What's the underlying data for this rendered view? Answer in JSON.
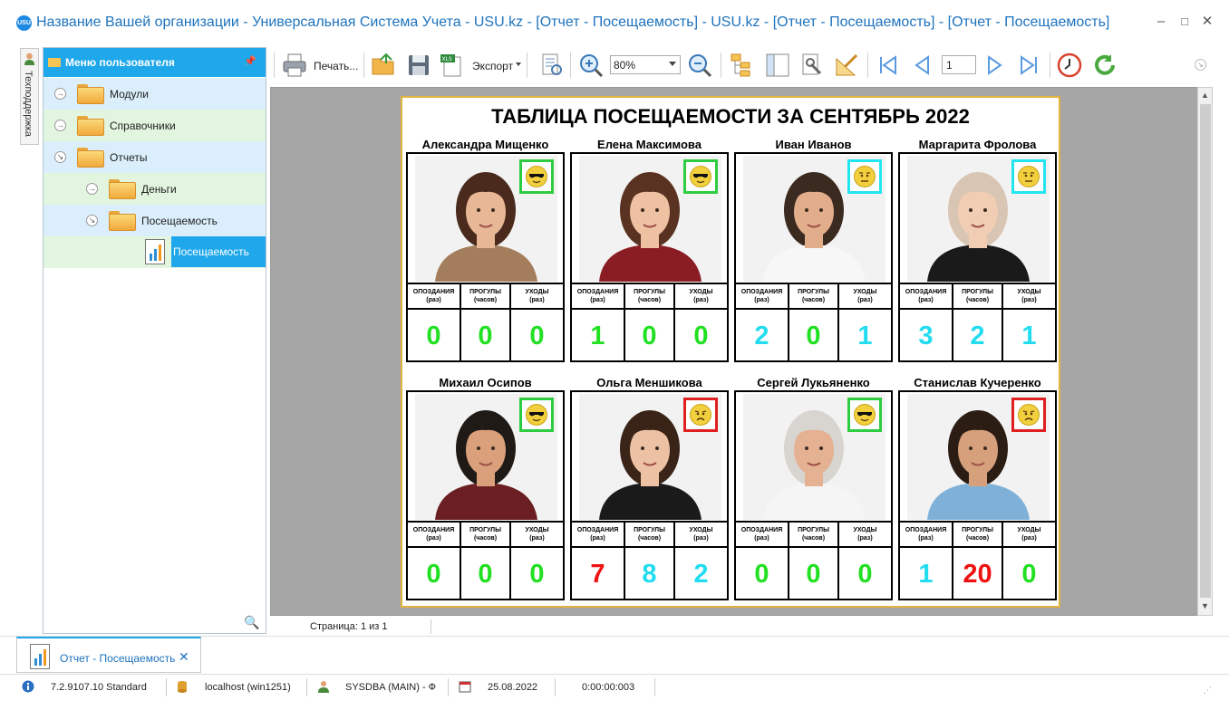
{
  "window": {
    "title": "Название Вашей организации - Универсальная Система Учета - USU.kz - [Отчет - Посещаемость] - USU.kz - [Отчет - Посещаемость] - [Отчет - Посещаемость]",
    "logo_text": "USU",
    "controls": {
      "minimize": "–",
      "maximize": "□",
      "close": "✕"
    }
  },
  "side_tab": {
    "label": "Техподдержка"
  },
  "menu": {
    "title": "Меню пользователя",
    "pin": "📌",
    "items": [
      {
        "label": "Модули",
        "expander": "→"
      },
      {
        "label": "Справочники",
        "expander": "→"
      },
      {
        "label": "Отчеты",
        "expander": "↘"
      },
      {
        "label": "Деньги",
        "expander": "→"
      },
      {
        "label": "Посещаемость",
        "expander": "↘"
      },
      {
        "label": "Посещаемость",
        "selected": true
      }
    ],
    "search_icon": "🔍"
  },
  "toolbar": {
    "print_label": "Печать...",
    "export_label": "Экспорт",
    "zoom_value": "80%",
    "page_value": "1"
  },
  "report": {
    "title": "ТАБЛИЦА ПОСЕЩАЕМОСТИ ЗА СЕНТЯБРЬ 2022",
    "col_lates": "ОПОЗДАНИЯ",
    "col_lates_unit": "(раз)",
    "col_absent": "ПРОГУЛЫ",
    "col_absent_unit": "(часов)",
    "col_leaves": "УХОДЫ",
    "col_leaves_unit": "(раз)",
    "employees": [
      {
        "name": "Александра Мищенко",
        "mood": "cool",
        "mood_color": "#2ecc40",
        "values": [
          "0",
          "0",
          "0"
        ],
        "colors": [
          "#22e022",
          "#22e022",
          "#22e022"
        ],
        "hair": "#4a2a1c",
        "shirt": "#a47d5c",
        "skin": "#e8b896"
      },
      {
        "name": "Елена Максимова",
        "mood": "cool",
        "mood_color": "#2ecc40",
        "values": [
          "1",
          "0",
          "0"
        ],
        "colors": [
          "#22e022",
          "#22e022",
          "#22e022"
        ],
        "hair": "#5a3222",
        "shirt": "#8a1c24",
        "skin": "#eec1a2"
      },
      {
        "name": "Иван Иванов",
        "mood": "neutral",
        "mood_color": "#22e5f0",
        "values": [
          "2",
          "0",
          "1"
        ],
        "colors": [
          "#22dcf0",
          "#22e022",
          "#22dcf0"
        ],
        "hair": "#3b2a20",
        "shirt": "#f7f7f7",
        "skin": "#e1ad8a"
      },
      {
        "name": "Маргарита Фролова",
        "mood": "neutral",
        "mood_color": "#22e5f0",
        "values": [
          "3",
          "2",
          "1"
        ],
        "colors": [
          "#22dcf0",
          "#22dcf0",
          "#22dcf0"
        ],
        "hair": "#d9c5b3",
        "shirt": "#1a1a1a",
        "skin": "#f1cdb4"
      },
      {
        "name": "Михаил Осипов",
        "mood": "cool",
        "mood_color": "#2ecc40",
        "values": [
          "0",
          "0",
          "0"
        ],
        "colors": [
          "#22e022",
          "#22e022",
          "#22e022"
        ],
        "hair": "#1f1a16",
        "shirt": "#6b1f22",
        "skin": "#d9a07b"
      },
      {
        "name": "Ольга Меншикова",
        "mood": "sad",
        "mood_color": "#e02020",
        "values": [
          "7",
          "8",
          "2"
        ],
        "colors": [
          "#ee1111",
          "#22dcf0",
          "#22dcf0"
        ],
        "hair": "#3a2418",
        "shirt": "#1a1a1a",
        "skin": "#edc1a4"
      },
      {
        "name": "Сергей Лукьяненко",
        "mood": "cool",
        "mood_color": "#2ecc40",
        "values": [
          "0",
          "0",
          "0"
        ],
        "colors": [
          "#22e022",
          "#22e022",
          "#22e022"
        ],
        "hair": "#d8d4cf",
        "shirt": "#f5f5f5",
        "skin": "#e4b193"
      },
      {
        "name": "Станислав Кучеренко",
        "mood": "sad",
        "mood_color": "#e02020",
        "values": [
          "1",
          "20",
          "0"
        ],
        "colors": [
          "#22dcf0",
          "#ee1111",
          "#22e022"
        ],
        "hair": "#2c1d14",
        "shirt": "#7fb1d8",
        "skin": "#d6a07c"
      }
    ]
  },
  "viewer_status": {
    "page_text": "Страница: 1 из 1"
  },
  "doc_tab": {
    "label": "Отчет - Посещаемость",
    "close": "✕"
  },
  "statusbar": {
    "version": "7.2.9107.10 Standard",
    "server": "localhost (win1251)",
    "user": "SYSDBA (MAIN) - Ф",
    "date": "25.08.2022",
    "timer": "0:00:00:003"
  }
}
